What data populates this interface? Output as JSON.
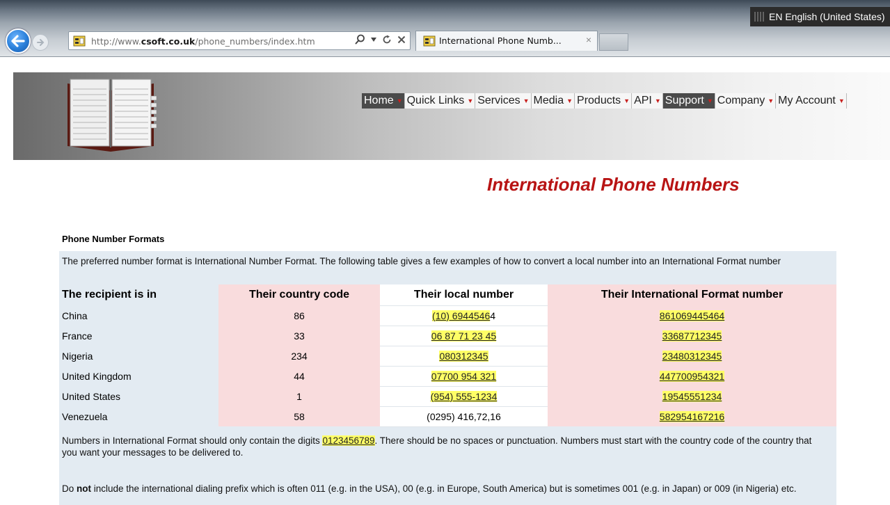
{
  "browser": {
    "language_indicator": "EN English (United States)",
    "url_plain": "http://www.",
    "url_domain": "csoft.co.uk",
    "url_path": "/phone_numbers/index.htm",
    "tab_title": "International Phone Numb...",
    "tab_close": "×",
    "colors": {
      "back_button": "#2a7fd9",
      "tab_bg": "#f3f5f7"
    }
  },
  "site": {
    "nav": [
      {
        "label": "Home",
        "active": true
      },
      {
        "label": "Quick Links",
        "active": false
      },
      {
        "label": "Services",
        "active": false
      },
      {
        "label": "Media",
        "active": false
      },
      {
        "label": "Products",
        "active": false
      },
      {
        "label": "API",
        "active": false
      },
      {
        "label": "Support",
        "active": true
      },
      {
        "label": "Company",
        "active": false
      },
      {
        "label": "My Account",
        "active": false
      }
    ],
    "dropdown_arrow": "▼"
  },
  "page": {
    "title": "International Phone Numbers",
    "title_color": "#b81414",
    "section_title": "Phone Number Formats",
    "intro": "The preferred number format is International Number Format. The following table gives a few examples of how to convert a local number into an International Format number",
    "table": {
      "headers": [
        "The recipient is in",
        "Their country code",
        "Their local number",
        "Their International Format number"
      ],
      "rows": [
        {
          "country": "China",
          "code": "86",
          "local_hl": "(10) 6944546",
          "local_rest": "4",
          "intl": "861069445464"
        },
        {
          "country": "France",
          "code": "33",
          "local_hl": "06 87 71 23 45",
          "local_rest": "",
          "intl": "33687712345"
        },
        {
          "country": "Nigeria",
          "code": "234",
          "local_hl": "080312345",
          "local_rest": "",
          "intl": "23480312345"
        },
        {
          "country": "United Kingdom",
          "code": "44",
          "local_hl": "07700 954 321",
          "local_rest": "",
          "intl": "447700954321"
        },
        {
          "country": "United States",
          "code": "1",
          "local_hl": "(954) 555-1234",
          "local_rest": "",
          "intl": "19545551234"
        },
        {
          "country": "Venezuela",
          "code": "58",
          "local_hl": "",
          "local_rest": "(0295) 416,72,16",
          "intl": "582954167216"
        }
      ]
    },
    "footer1_a": "Numbers in International Format should only contain the digits ",
    "footer1_digits": "0123456789",
    "footer1_b": ". There should be no spaces or punctuation. Numbers must start with the country code of the country that you want your messages to be delivered to.",
    "footer2_a": "Do ",
    "footer2_bold": "not",
    "footer2_b": " include the international dialing prefix which is often 011 (e.g. in the USA), 00 (e.g. in Europe, South America) but is sometimes 001 (e.g. in Japan) or 009 (in Nigeria) etc."
  }
}
